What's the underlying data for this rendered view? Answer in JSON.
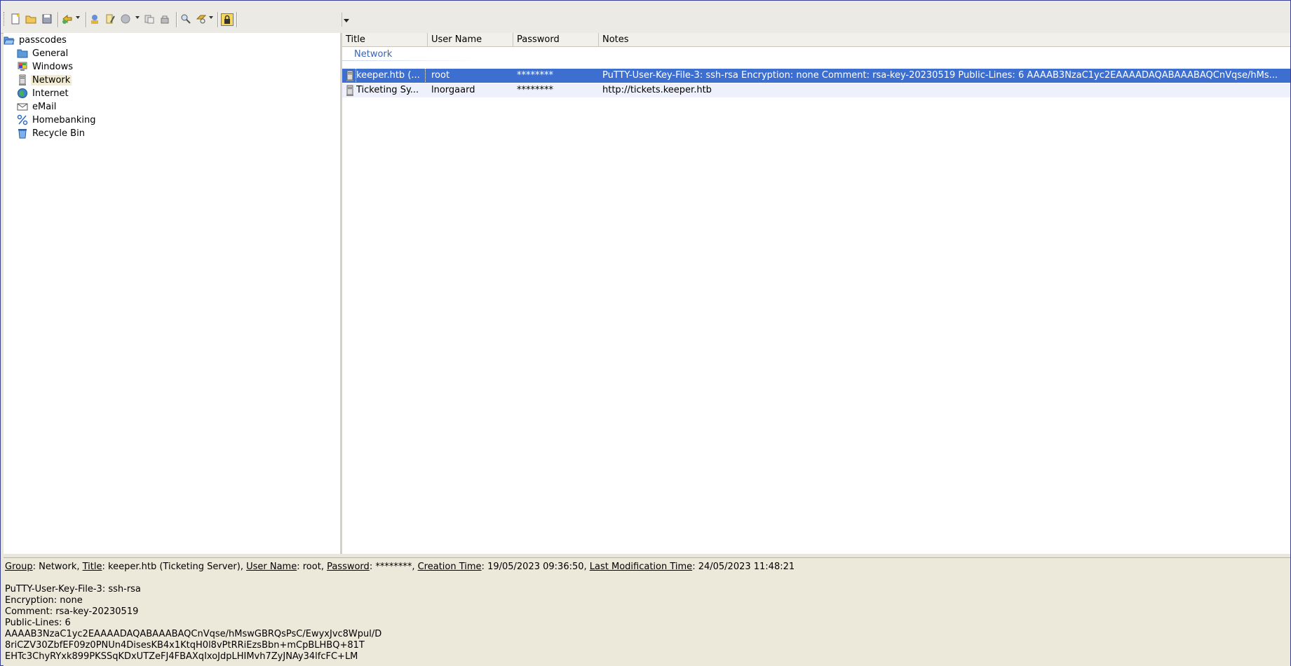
{
  "toolbar": {
    "icons": [
      "new-database-icon",
      "open-database-icon",
      "save-icon",
      "add-entry-icon",
      "add-group-icon",
      "edit-icon",
      "delete-icon",
      "copy-username-icon",
      "copy-password-icon",
      "search-icon",
      "find-icon",
      "lock-icon"
    ],
    "quickfind_value": ""
  },
  "tree": {
    "root": "passcodes",
    "groups": [
      {
        "label": "General",
        "icon": "folder-icon"
      },
      {
        "label": "Windows",
        "icon": "windows-icon"
      },
      {
        "label": "Network",
        "icon": "network-icon"
      },
      {
        "label": "Internet",
        "icon": "globe-icon"
      },
      {
        "label": "eMail",
        "icon": "email-icon"
      },
      {
        "label": "Homebanking",
        "icon": "percent-icon"
      },
      {
        "label": "Recycle Bin",
        "icon": "recycle-bin-icon"
      }
    ],
    "selected": "Network"
  },
  "list": {
    "columns": [
      "Title",
      "User Name",
      "Password",
      "Notes"
    ],
    "group_header": "Network",
    "rows": [
      {
        "title": "keeper.htb (...",
        "username": "root",
        "password": "********",
        "notes": "PuTTY-User-Key-File-3: ssh-rsa Encryption: none Comment: rsa-key-20230519 Public-Lines: 6 AAAAB3NzaC1yc2EAAAADAQABAAABAQCnVqse/hMs..."
      },
      {
        "title": "Ticketing Sy...",
        "username": "lnorgaard",
        "password": "********",
        "notes": "http://tickets.keeper.htb"
      }
    ]
  },
  "details": {
    "group_label": "Group",
    "group_value": "Network",
    "title_label": "Title",
    "title_value": "keeper.htb (Ticketing Server)",
    "username_label": "User Name",
    "username_value": "root",
    "password_label": "Password",
    "password_value": "********",
    "created_label": "Creation Time",
    "created_value": "19/05/2023 09:36:50",
    "modified_label": "Last Modification Time",
    "modified_value": "24/05/2023 11:48:21",
    "notes_lines": [
      "PuTTY-User-Key-File-3: ssh-rsa",
      "Encryption: none",
      "Comment: rsa-key-20230519",
      "Public-Lines: 6",
      "AAAAB3NzaC1yc2EAAAADAQABAAABAQCnVqse/hMswGBRQsPsC/EwyxJvc8Wpul/D",
      "8riCZV30ZbfEF09z0PNUn4DisesKB4x1KtqH0l8vPtRRiEzsBbn+mCpBLHBQ+81T",
      "EHTc3ChyRYxk899PKSSqKDxUTZeFJ4FBAXqIxoJdpLHIMvh7ZyJNAy34lfcFC+LM"
    ]
  },
  "colors": {
    "selection": "#3c6fd0",
    "group_header": "#3a63b0",
    "panel_bg": "#ece9da"
  }
}
